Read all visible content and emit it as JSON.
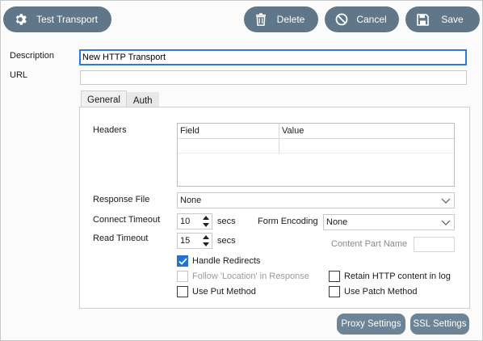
{
  "toolbar": {
    "test_transport_label": "Test Transport",
    "delete_label": "Delete",
    "cancel_label": "Cancel",
    "save_label": "Save",
    "button_color": "#5f7789"
  },
  "form": {
    "description_label": "Description",
    "description_value": "New HTTP Transport",
    "url_label": "URL",
    "url_value": ""
  },
  "tabs": [
    {
      "label": "General",
      "active": true
    },
    {
      "label": "Auth",
      "active": false
    }
  ],
  "general": {
    "headers_label": "Headers",
    "headers_columns": [
      "Field",
      "Value"
    ],
    "response_file_label": "Response File",
    "response_file_value": "None",
    "connect_timeout_label": "Connect Timeout",
    "connect_timeout_value": "10",
    "connect_timeout_unit": "secs",
    "read_timeout_label": "Read Timeout",
    "read_timeout_value": "15",
    "read_timeout_unit": "secs",
    "form_encoding_label": "Form Encoding",
    "form_encoding_value": "None",
    "content_part_name_label": "Content Part Name",
    "content_part_name_value": "",
    "handle_redirects_label": "Handle Redirects",
    "handle_redirects_checked": true,
    "follow_location_label": "Follow 'Location' in Response",
    "follow_location_checked": false,
    "use_put_label": "Use Put Method",
    "use_put_checked": false,
    "retain_http_label": "Retain HTTP content in log",
    "retain_http_checked": false,
    "use_patch_label": "Use Patch Method",
    "use_patch_checked": false
  },
  "footer": {
    "proxy_settings_label": "Proxy Settings",
    "ssl_settings_label": "SSL Settings"
  },
  "icons": {
    "test_transport": "gear-icon",
    "delete": "trash-icon",
    "cancel": "cancel-icon",
    "save": "floppy-disk-icon"
  }
}
